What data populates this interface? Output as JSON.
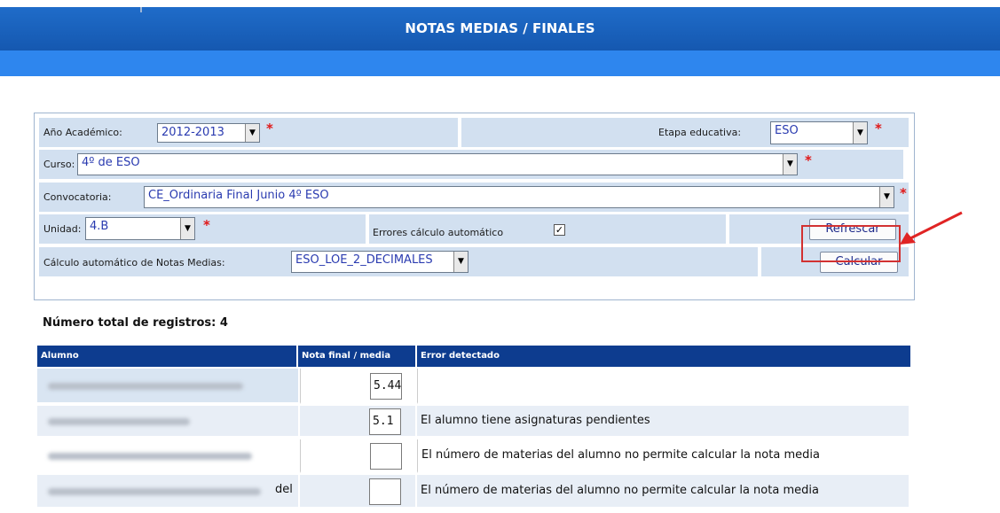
{
  "header": {
    "title": "NOTAS MEDIAS / FINALES"
  },
  "form": {
    "year_label": "Año Académico:",
    "year_value": "2012-2013",
    "stage_label": "Etapa educativa:",
    "stage_value": "ESO",
    "course_label": "Curso:",
    "course_value": "4º de ESO",
    "call_label": "Convocatoria:",
    "call_value": "CE_Ordinaria Final Junio 4º ESO",
    "unit_label": "Unidad:",
    "unit_value": "4.B",
    "errors_label": "Errores cálculo automático",
    "errors_checked": "✓",
    "refresh_label": "Refrescar",
    "avg_label": "Cálculo automático de Notas Medias:",
    "avg_value": "ESO_LOE_2_DECIMALES",
    "calc_label": "Calcular",
    "required_mark": "*",
    "dropdown_arrow": "▼"
  },
  "results": {
    "count_text": "Número total de registros: 4",
    "columns": [
      "Alumno",
      "Nota final / media",
      "Error detectado"
    ],
    "rows": [
      {
        "name_suffix": "",
        "grade": "5.44",
        "error": ""
      },
      {
        "name_suffix": "",
        "grade": "5.1",
        "error": "El alumno tiene asignaturas pendientes"
      },
      {
        "name_suffix": "",
        "grade": "",
        "error": "El número de materias del alumno no permite calcular la nota media"
      },
      {
        "name_suffix": "del",
        "grade": "",
        "error": "El número de materias del alumno no permite calcular la nota media"
      }
    ]
  },
  "colors": {
    "header_bg": "#1558b0",
    "subbar_bg": "#2e86ee",
    "row_bg": "#d2e0f0",
    "grid_header_bg": "#0d3c8f",
    "highlight": "#d23131"
  },
  "icons": [
    "dropdown-arrow-icon",
    "checkbox-icon",
    "red-arrow-icon"
  ]
}
